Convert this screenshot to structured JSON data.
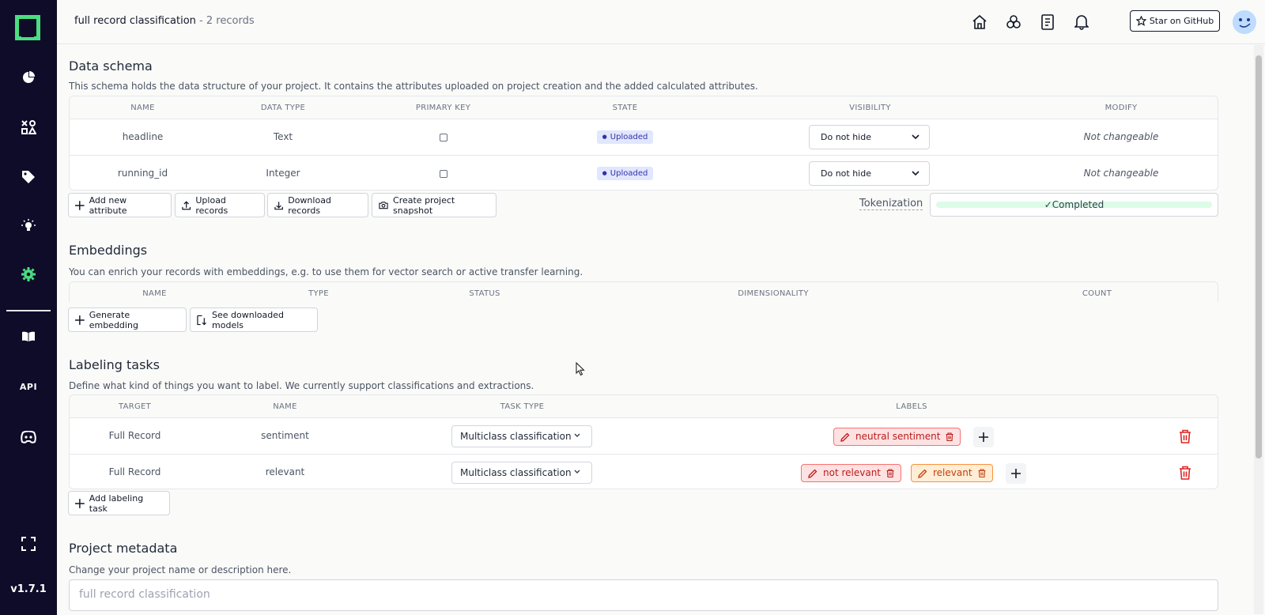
{
  "app": {
    "version": "v1.7.1",
    "sidebar": {
      "items": [
        {
          "name": "overview",
          "icon": "pie-chart-icon"
        },
        {
          "name": "data-browser",
          "icon": "shapes-icon"
        },
        {
          "name": "labeling",
          "icon": "tag-icon"
        },
        {
          "name": "heuristics",
          "icon": "bulb-icon"
        },
        {
          "name": "settings",
          "icon": "gear-icon",
          "active": true
        },
        {
          "name": "docs",
          "icon": "book-icon"
        },
        {
          "name": "api",
          "label": "API"
        },
        {
          "name": "discord",
          "icon": "discord-icon"
        },
        {
          "name": "fullscreen",
          "icon": "fullscreen-icon"
        }
      ],
      "accent_color": "#4ade80",
      "bg_color": "#0f0c29"
    }
  },
  "header": {
    "project_name": "full record classification",
    "separator": "-",
    "record_count": "2 records",
    "github_label": "Star on GitHub"
  },
  "schema": {
    "title": "Data schema",
    "description": "This schema holds the data structure of your project. It contains the attributes uploaded on project creation and the added calculated attributes.",
    "columns": [
      "NAME",
      "DATA TYPE",
      "PRIMARY KEY",
      "STATE",
      "VISIBILITY",
      "MODIFY"
    ],
    "rows": [
      {
        "name": "headline",
        "type": "Text",
        "primary": false,
        "state": "Uploaded",
        "visibility": "Do not hide",
        "modify": "Not changeable"
      },
      {
        "name": "running_id",
        "type": "Integer",
        "primary": false,
        "state": "Uploaded",
        "visibility": "Do not hide",
        "modify": "Not changeable"
      }
    ],
    "buttons": {
      "add_attribute": "Add new attribute",
      "upload": "Upload records",
      "download": "Download records",
      "snapshot": "Create project snapshot"
    },
    "tokenization_label": "Tokenization",
    "tokenization_status": "Completed",
    "tokenization_progress": 1.0
  },
  "embeddings": {
    "title": "Embeddings",
    "description": "You can enrich your records with embeddings, e.g. to use them for vector search or active transfer learning.",
    "columns": [
      "NAME",
      "TYPE",
      "STATUS",
      "DIMENSIONALITY",
      "COUNT"
    ],
    "buttons": {
      "generate": "Generate embedding",
      "models": "See downloaded models"
    }
  },
  "labeling": {
    "title": "Labeling tasks",
    "description": "Define what kind of things you want to label. We currently support classifications and extractions.",
    "columns": [
      "TARGET",
      "NAME",
      "TASK TYPE",
      "LABELS"
    ],
    "rows": [
      {
        "target": "Full Record",
        "name": "sentiment",
        "task_type": "Multiclass classification",
        "labels": [
          {
            "text": "neutral sentiment",
            "color": "red"
          }
        ]
      },
      {
        "target": "Full Record",
        "name": "relevant",
        "task_type": "Multiclass classification",
        "labels": [
          {
            "text": "not relevant",
            "color": "red"
          },
          {
            "text": "relevant",
            "color": "orange"
          }
        ]
      }
    ],
    "add_button": "Add labeling task"
  },
  "metadata": {
    "title": "Project metadata",
    "description": "Change your project name or description here.",
    "name_value": "full record classification"
  }
}
